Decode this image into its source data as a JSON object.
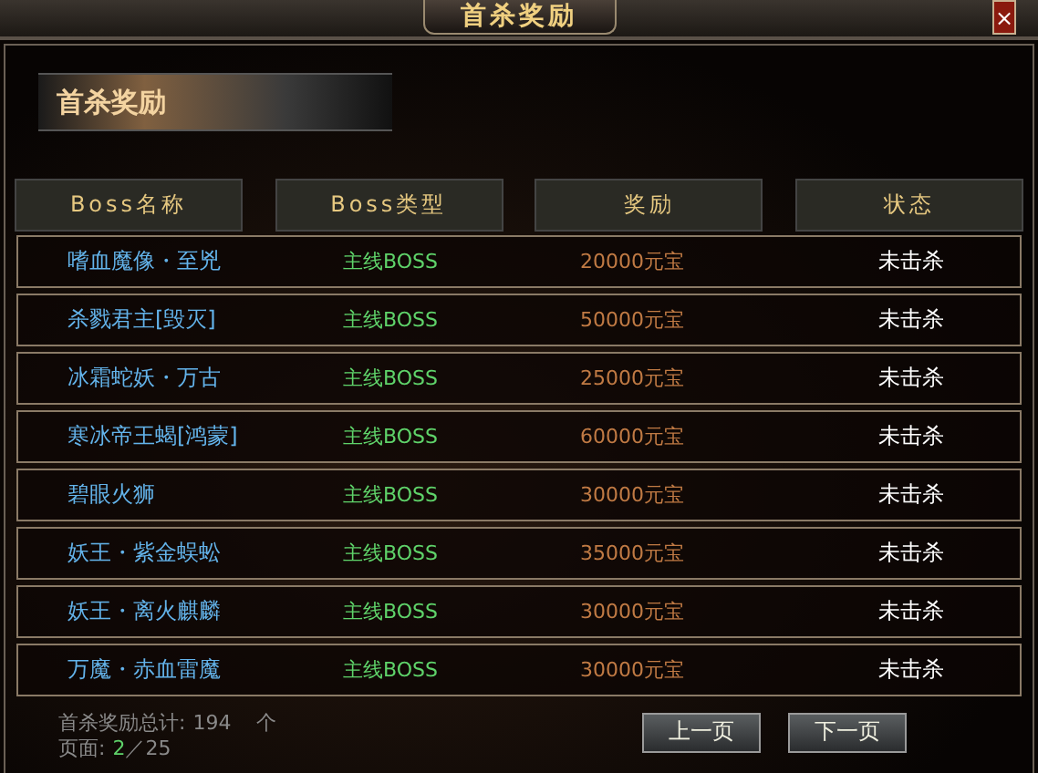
{
  "window": {
    "title": "首杀奖励",
    "close": "×"
  },
  "banner": "首杀奖励",
  "table": {
    "columns": [
      "Boss名称",
      "Boss类型",
      "奖励",
      "状态"
    ],
    "rows": [
      {
        "name": "嗜血魔像・至兇",
        "type": "主线BOSS",
        "reward": "20000元宝",
        "status": "未击杀"
      },
      {
        "name": "杀戮君主[毁灭]",
        "type": "主线BOSS",
        "reward": "50000元宝",
        "status": "未击杀"
      },
      {
        "name": "冰霜蛇妖・万古",
        "type": "主线BOSS",
        "reward": "25000元宝",
        "status": "未击杀"
      },
      {
        "name": "寒冰帝王蝎[鸿蒙]",
        "type": "主线BOSS",
        "reward": "60000元宝",
        "status": "未击杀"
      },
      {
        "name": "碧眼火狮",
        "type": "主线BOSS",
        "reward": "30000元宝",
        "status": "未击杀"
      },
      {
        "name": "妖王・紫金蜈蚣",
        "type": "主线BOSS",
        "reward": "35000元宝",
        "status": "未击杀"
      },
      {
        "name": "妖王・离火麒麟",
        "type": "主线BOSS",
        "reward": "30000元宝",
        "status": "未击杀"
      },
      {
        "name": "万魔・赤血雷魔",
        "type": "主线BOSS",
        "reward": "30000元宝",
        "status": "未击杀"
      }
    ]
  },
  "footer": {
    "total_label": "首杀奖励总计:",
    "total": "194",
    "total_unit": "个",
    "page_label": "页面:",
    "page_current": "2",
    "page_total": "／25"
  },
  "buttons": [
    "上一页",
    "下一页"
  ]
}
